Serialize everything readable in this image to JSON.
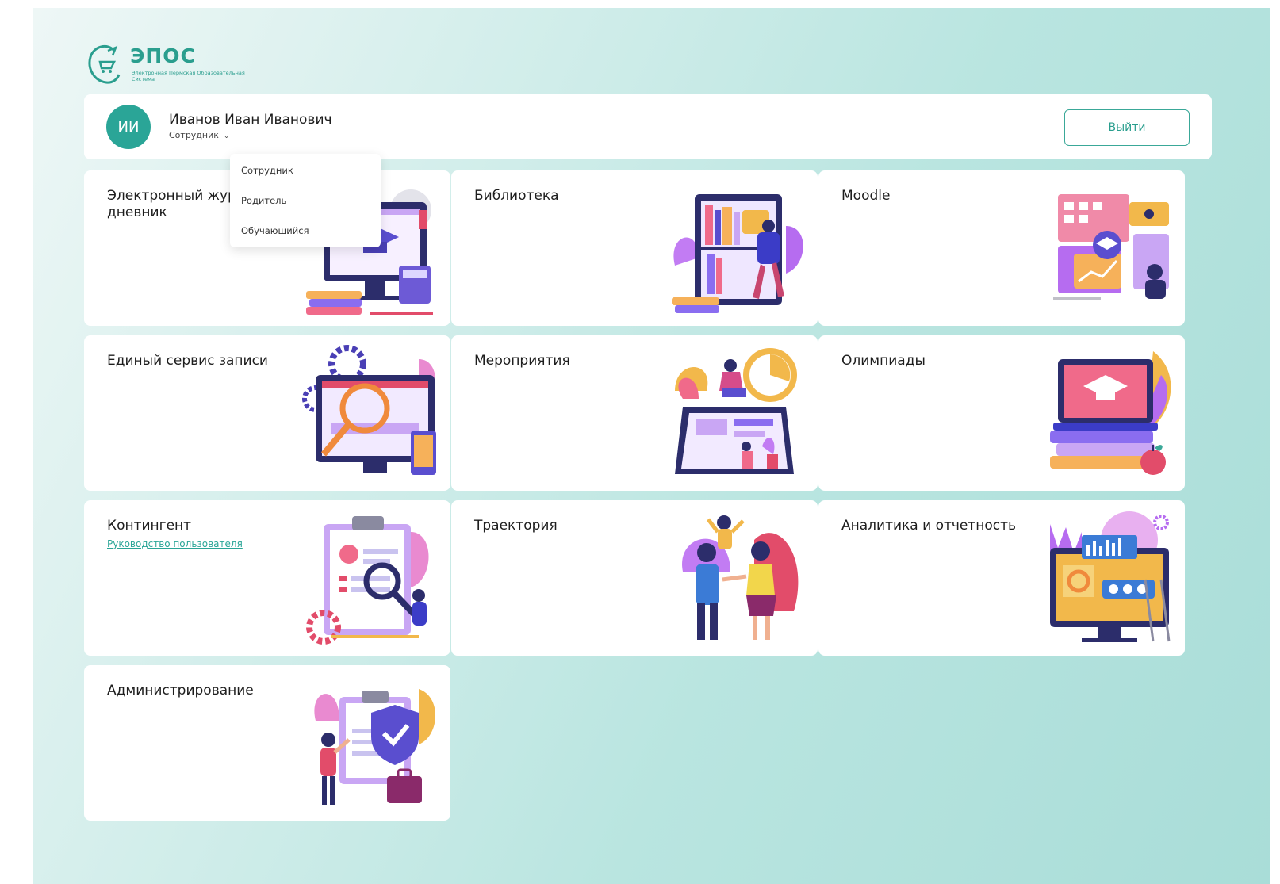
{
  "logo": {
    "title": "ЭПОС",
    "subtitle": "Электронная Пермская Образовательная Система"
  },
  "user": {
    "initials": "ИИ",
    "name": "Иванов Иван Иванович",
    "role": "Сотрудник"
  },
  "header": {
    "logout_label": "Выйти"
  },
  "role_menu": {
    "items": [
      "Сотрудник",
      "Родитель",
      "Обучающийся"
    ]
  },
  "cards": [
    {
      "title": "Электронный журнал и дневник"
    },
    {
      "title": "Библиотека"
    },
    {
      "title": "Moodle"
    },
    {
      "title": "Единый сервис записи"
    },
    {
      "title": "Мероприятия"
    },
    {
      "title": "Олимпиады"
    },
    {
      "title": "Контингент",
      "link": "Руководство пользователя"
    },
    {
      "title": "Траектория"
    },
    {
      "title": "Аналитика и отчетность"
    },
    {
      "title": "Администрирование"
    }
  ],
  "colors": {
    "accent": "#2aa597",
    "background_gradient": [
      "#eef7f6",
      "#a9ddd8"
    ]
  }
}
